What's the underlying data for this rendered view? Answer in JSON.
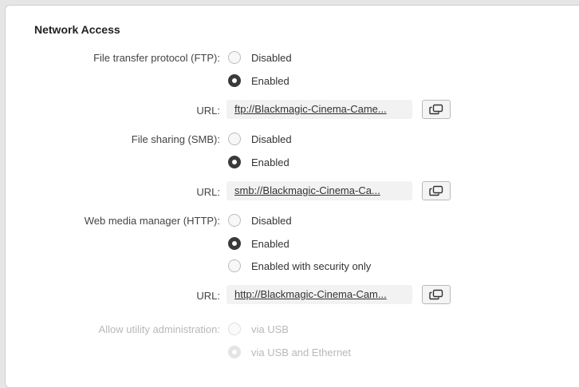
{
  "section": {
    "title": "Network Access"
  },
  "ftp": {
    "label": "File transfer protocol (FTP):",
    "options": [
      "Disabled",
      "Enabled"
    ],
    "selected": "Enabled",
    "url_label": "URL:",
    "url": "ftp://Blackmagic-Cinema-Came..."
  },
  "smb": {
    "label": "File sharing (SMB):",
    "options": [
      "Disabled",
      "Enabled"
    ],
    "selected": "Enabled",
    "url_label": "URL:",
    "url": "smb://Blackmagic-Cinema-Ca..."
  },
  "http": {
    "label": "Web media manager (HTTP):",
    "options": [
      "Disabled",
      "Enabled",
      "Enabled with security only"
    ],
    "selected": "Enabled",
    "url_label": "URL:",
    "url": "http://Blackmagic-Cinema-Cam..."
  },
  "utility": {
    "label": "Allow utility administration:",
    "options": [
      "via USB",
      "via USB and Ethernet"
    ],
    "selected": "via USB and Ethernet",
    "disabled": true
  },
  "icons": {
    "copy": "copy-icon"
  },
  "colors": {
    "selected_radio": "#3a3a3a",
    "muted_text": "#b8b8b8"
  }
}
